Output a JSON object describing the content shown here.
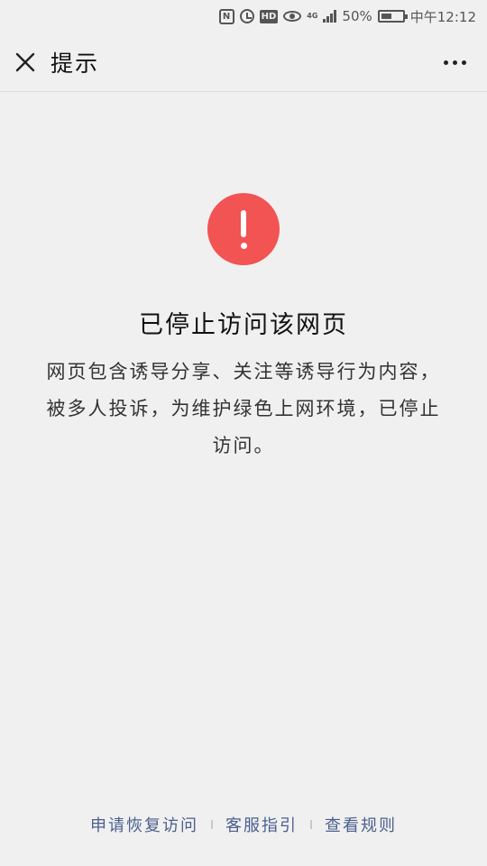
{
  "status_bar": {
    "nfc_icon": "nfc-icon",
    "hd_label": "HD",
    "network_label": "4G",
    "battery_percent_text": "50%",
    "battery_level": 0.5,
    "time": "中午12:12"
  },
  "title_bar": {
    "close_icon": "close-icon",
    "title": "提示",
    "more_icon": "more-icon"
  },
  "main": {
    "alert_icon": "exclamation-icon",
    "alert_color": "#f25353",
    "heading": "已停止访问该网页",
    "message": "网页包含诱导分享、关注等诱导行为内容，被多人投诉，为维护绿色上网环境，已停止访问。"
  },
  "footer": {
    "links": [
      "申请恢复访问",
      "客服指引",
      "查看规则"
    ],
    "link_color": "#4b5f8d"
  }
}
